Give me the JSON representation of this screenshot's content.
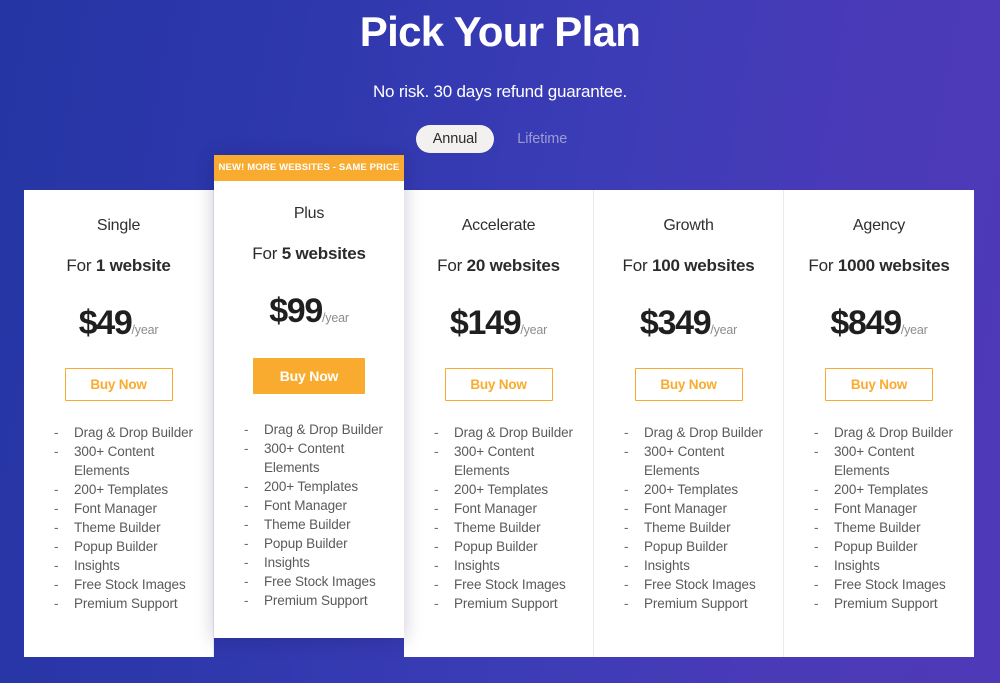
{
  "header": {
    "title": "Pick Your Plan",
    "subtitle": "No risk. 30 days refund guarantee."
  },
  "billing_toggle": {
    "annual_label": "Annual",
    "lifetime_label": "Lifetime",
    "selected": "Annual"
  },
  "featured_badge": "NEW! MORE WEBSITES - SAME PRICE",
  "colors": {
    "accent_orange": "#f9ab2f",
    "background_left": "#2535a3",
    "background_right": "#4f39b9",
    "card_background": "#ffffff",
    "price_text": "#1f1f1f",
    "feature_text": "#5a5a5a",
    "toggle_active_background": "#f3f1ef",
    "toggle_inactive_text": "#9c9bd3"
  },
  "features": [
    "Drag & Drop Builder",
    "300+ Content Elements",
    "200+ Templates",
    "Font Manager",
    "Theme Builder",
    "Popup Builder",
    "Insights",
    "Free Stock Images",
    "Premium Support"
  ],
  "feature_bullet": "-",
  "plans": [
    {
      "name": "Single",
      "websites_prefix": "For ",
      "websites_count": "1 website",
      "price": "$49",
      "period": "/year",
      "cta": "Buy Now",
      "featured": false
    },
    {
      "name": "Plus",
      "websites_prefix": "For ",
      "websites_count": "5 websites",
      "price": "$99",
      "period": "/year",
      "cta": "Buy Now",
      "featured": true
    },
    {
      "name": "Accelerate",
      "websites_prefix": "For ",
      "websites_count": "20 websites",
      "price": "$149",
      "period": "/year",
      "cta": "Buy Now",
      "featured": false
    },
    {
      "name": "Growth",
      "websites_prefix": "For ",
      "websites_count": "100 websites",
      "price": "$349",
      "period": "/year",
      "cta": "Buy Now",
      "featured": false
    },
    {
      "name": "Agency",
      "websites_prefix": "For ",
      "websites_count": "1000 websites",
      "price": "$849",
      "period": "/year",
      "cta": "Buy Now",
      "featured": false
    }
  ]
}
